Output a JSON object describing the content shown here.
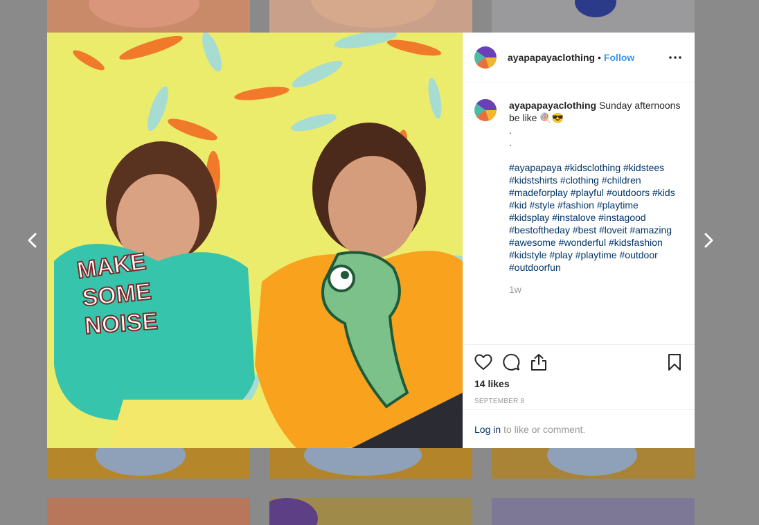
{
  "post": {
    "username": "ayapapayaclothing",
    "separator": "•",
    "follow_label": "Follow",
    "caption_text": "Sunday afternoons be like 🍭😎",
    "caption_dots": [
      ".",
      "."
    ],
    "hashtag_rows": [
      "#ayapapaya #kidsclothing #kidstees",
      "#kidstshirts #clothing #children",
      "#madeforplay #playful #outdoors #kids",
      "#kid #style #fashion #playtime",
      "#kidsplay #instalove #instagood",
      "#bestoftheday #best #loveit #amazing",
      "#awesome #wonderful #kidsfashion",
      "#kidstyle #play #playtime #outdoor",
      "#outdoorfun"
    ],
    "time_ago": "1w",
    "likes": "14 likes",
    "date": "SEPTEMBER 8",
    "login_link": "Log in",
    "login_suffix": "to like or comment.",
    "image_text": [
      "MAKE",
      "SOME",
      "NOISE"
    ]
  },
  "icons": {
    "more": "more-horizontal-icon",
    "like": "heart-icon",
    "comment": "comment-icon",
    "share": "share-icon",
    "save": "bookmark-icon",
    "prev": "chevron-left-icon",
    "next": "chevron-right-icon"
  },
  "colors": {
    "link_blue": "#3897f0",
    "hashtag": "#003569",
    "muted": "#999999",
    "image_background": "#e9e86a"
  }
}
